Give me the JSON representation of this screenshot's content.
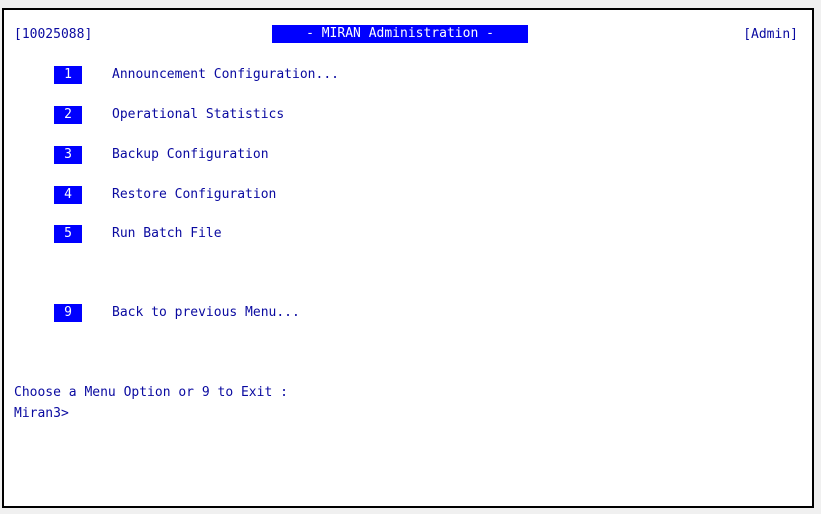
{
  "header": {
    "terminal_id": "[10025088]",
    "title": "- MIRAN Administration -",
    "user_role": "[Admin]"
  },
  "menu": {
    "items": [
      {
        "number": "1",
        "label": "Announcement Configuration..."
      },
      {
        "number": "2",
        "label": "Operational Statistics"
      },
      {
        "number": "3",
        "label": "Backup Configuration"
      },
      {
        "number": "4",
        "label": "Restore Configuration"
      },
      {
        "number": "5",
        "label": "Run Batch File"
      },
      {
        "number": "9",
        "label": "Back to previous Menu..."
      }
    ]
  },
  "prompt": {
    "text": "Choose a Menu Option or 9 to Exit :",
    "shell": "Miran3>"
  },
  "colors": {
    "text": "#0a0aa0",
    "highlight_bg": "#0000ff",
    "highlight_fg": "#ffffff",
    "background": "#ffffff",
    "border": "#000000"
  }
}
